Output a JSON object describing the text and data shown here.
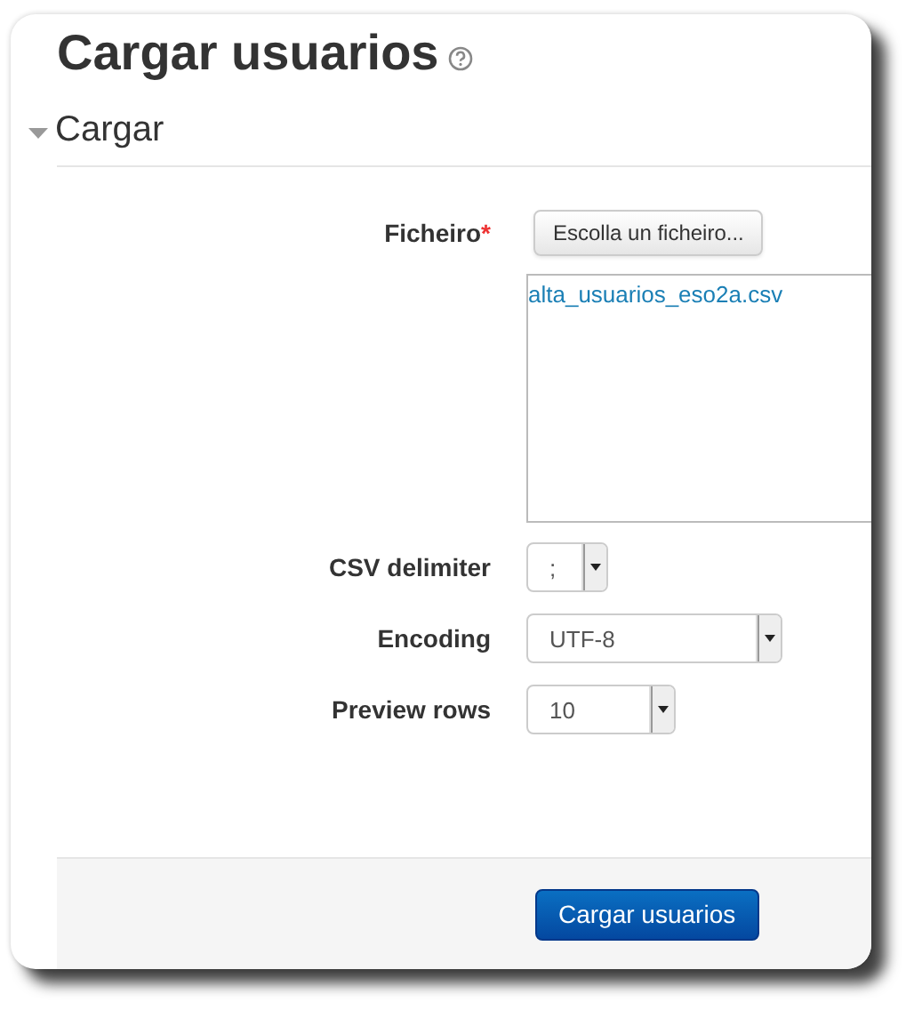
{
  "title": "Cargar usuarios",
  "section": {
    "label": "Cargar",
    "expanded": true
  },
  "file_field": {
    "label": "Ficheiro",
    "required": true,
    "required_mark": "*",
    "button": "Escolla un ficheiro...",
    "files": [
      "alta_usuarios_eso2a.csv"
    ]
  },
  "selects": [
    {
      "label": "CSV delimiter",
      "value": ";"
    },
    {
      "label": "Encoding",
      "value": "UTF-8"
    },
    {
      "label": "Preview rows",
      "value": "10"
    }
  ],
  "submit": "Cargar usuarios"
}
